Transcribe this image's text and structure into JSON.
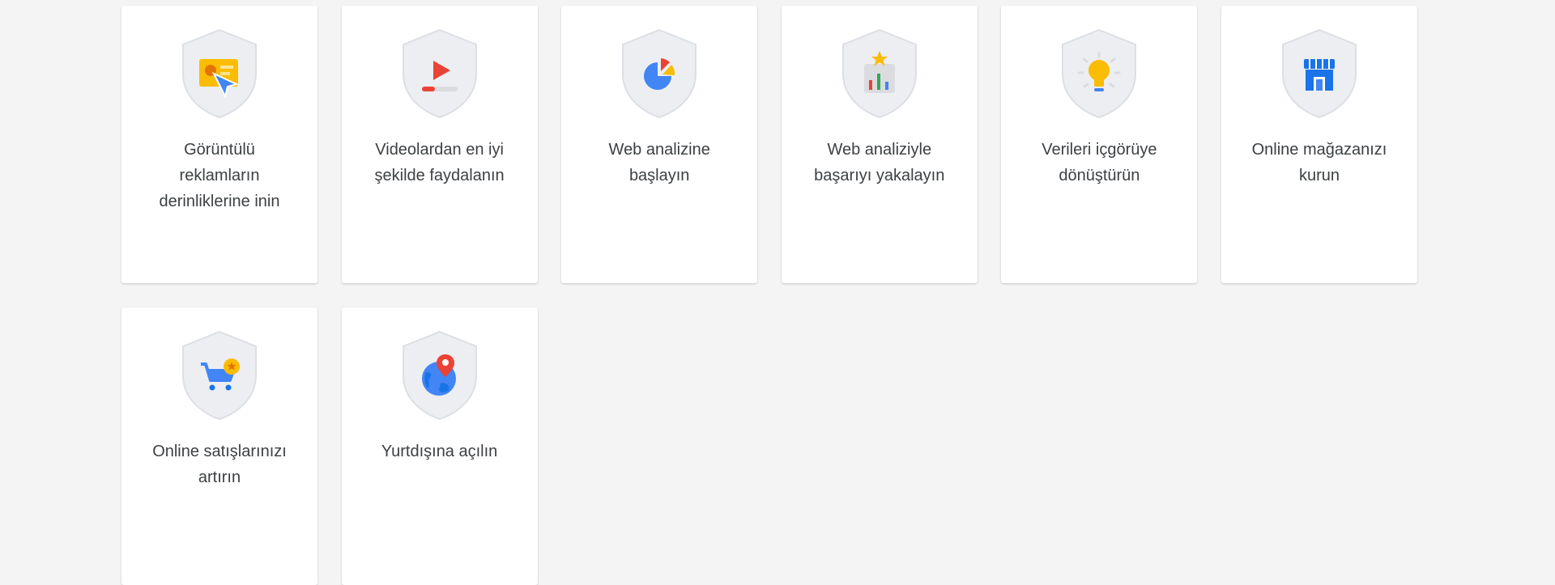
{
  "cards": [
    {
      "title": "Görüntülü reklamların derinliklerine inin",
      "icon": "display-ad-cursor-icon"
    },
    {
      "title": "Videolardan en iyi şekilde faydalanın",
      "icon": "video-play-icon"
    },
    {
      "title": "Web analizine başlayın",
      "icon": "pie-chart-icon"
    },
    {
      "title": "Web analiziyle başarıyı yakalayın",
      "icon": "bar-chart-star-icon"
    },
    {
      "title": "Verileri içgörüye dönüştürün",
      "icon": "lightbulb-icon"
    },
    {
      "title": "Online mağazanızı kurun",
      "icon": "storefront-icon"
    },
    {
      "title": "Online satışlarınızı artırın",
      "icon": "shopping-cart-icon"
    },
    {
      "title": "Yurtdışına açılın",
      "icon": "globe-pin-icon"
    }
  ],
  "colors": {
    "background": "#f4f4f4",
    "card": "#ffffff",
    "text": "#3c4043",
    "badge": "#eceef1",
    "blue": "#4285f4",
    "red": "#ea4335",
    "yellow": "#fbbc04",
    "green": "#34a853"
  }
}
